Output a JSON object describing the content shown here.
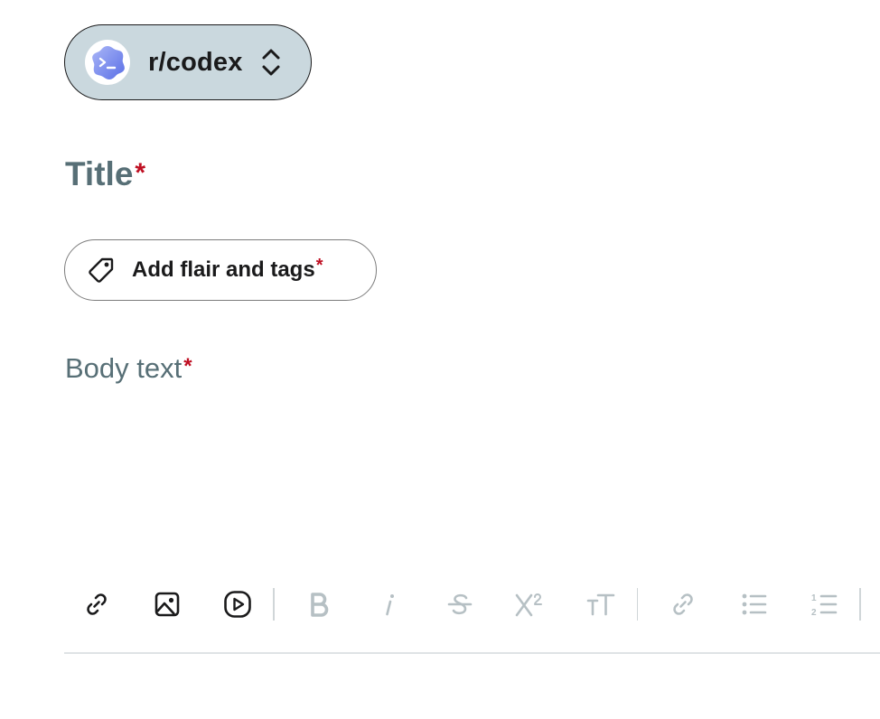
{
  "composer": {
    "community": {
      "name": "r/codex",
      "avatar_icon": "codex-community-icon",
      "selector_icon": "chevron-updown-icon"
    },
    "title": {
      "placeholder": "Title",
      "required_mark": "*"
    },
    "flair": {
      "label": "Add flair and tags",
      "required_mark": "*",
      "icon": "tag-icon"
    },
    "body": {
      "placeholder": "Body text",
      "required_mark": "*"
    },
    "toolbar": {
      "items": [
        {
          "name": "link",
          "icon": "link-icon",
          "enabled": true
        },
        {
          "name": "image",
          "icon": "image-icon",
          "enabled": true
        },
        {
          "name": "video",
          "icon": "video-icon",
          "enabled": true
        },
        {
          "name": "bold",
          "icon": "bold-icon",
          "enabled": false
        },
        {
          "name": "italic",
          "icon": "italic-icon",
          "enabled": false
        },
        {
          "name": "strikethrough",
          "icon": "strikethrough-icon",
          "enabled": false
        },
        {
          "name": "superscript",
          "icon": "superscript-icon",
          "enabled": false
        },
        {
          "name": "heading",
          "icon": "heading-icon",
          "enabled": false
        },
        {
          "name": "inline-link",
          "icon": "link-icon",
          "enabled": false
        },
        {
          "name": "bulleted-list",
          "icon": "bulleted-list-icon",
          "enabled": false
        },
        {
          "name": "numbered-list",
          "icon": "numbered-list-icon",
          "enabled": false
        }
      ]
    },
    "colors": {
      "pill_background": "#cad8de",
      "required": "#bf0f22",
      "placeholder": "#576f76",
      "disabled_icon": "#b6c0c4"
    }
  }
}
